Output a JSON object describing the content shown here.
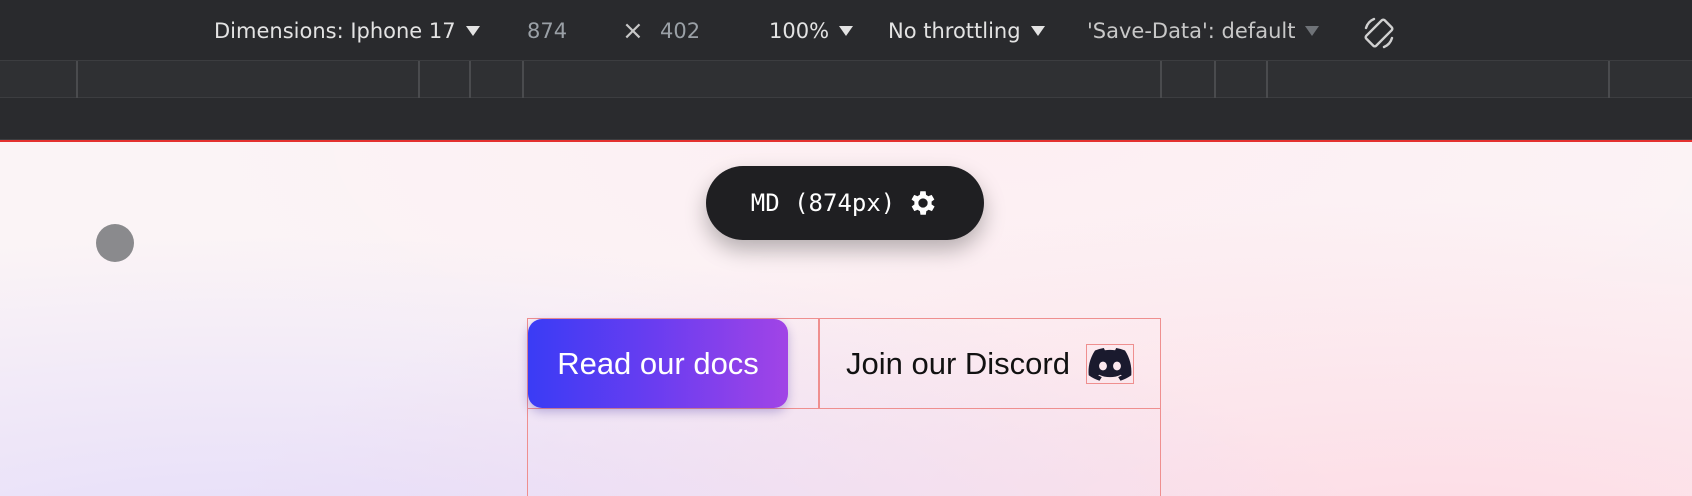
{
  "toolbar": {
    "dimensions_label": "Dimensions: Iphone 17",
    "width": "874",
    "times": "×",
    "height": "402",
    "zoom": "100%",
    "throttling": "No throttling",
    "save_data": "'Save-Data': default",
    "rotate_icon": "rotate-icon"
  },
  "viewport": {
    "breakpoint_label": "MD (874px)",
    "breakpoint_icon": "gear-icon",
    "docs_button": "Read our docs",
    "discord_button": "Join our Discord",
    "discord_icon": "discord-icon"
  },
  "colors": {
    "toolbar_bg": "#292a2d",
    "viewport_border": "#e4312f",
    "gradient_start": "#3a3cf5",
    "gradient_end": "#a144e6",
    "outline": "#ef8f8f"
  }
}
